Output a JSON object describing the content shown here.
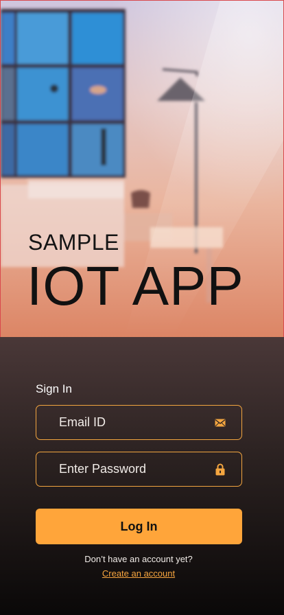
{
  "hero": {
    "title_small": "SAMPLE",
    "title_large": "IOT APP"
  },
  "signin": {
    "heading": "Sign In",
    "email_placeholder": "Email ID",
    "email_icon": "mail-icon",
    "password_placeholder": "Enter Password",
    "password_icon": "lock-icon",
    "login_label": "Log In",
    "no_account_text": "Don’t have an account yet?",
    "create_account_link": "Create an account"
  },
  "colors": {
    "accent": "#FFA53A",
    "panel_top": "#4A3838",
    "panel_bottom": "#0A0808",
    "hero_border": "#D9484C"
  }
}
